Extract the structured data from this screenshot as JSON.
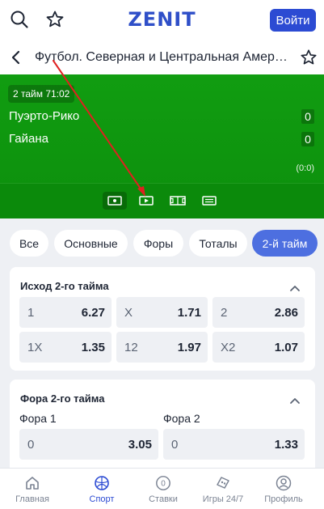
{
  "header": {
    "logo": "ZENIT",
    "login_label": "Войти"
  },
  "event": {
    "title": "Футбол. Северная и Центральная Америка",
    "period": "2 тайм 71:02",
    "team1": "Пуэрто-Рико",
    "team2": "Гайана",
    "score1": "0",
    "score2": "0",
    "subscore": "(0:0)"
  },
  "filters": [
    "Все",
    "Основные",
    "Форы",
    "Тоталы",
    "2-й тайм"
  ],
  "market1": {
    "title": "Исход 2-го тайма",
    "odds": [
      {
        "label": "1",
        "value": "6.27"
      },
      {
        "label": "X",
        "value": "1.71"
      },
      {
        "label": "2",
        "value": "2.86"
      },
      {
        "label": "1X",
        "value": "1.35"
      },
      {
        "label": "12",
        "value": "1.97"
      },
      {
        "label": "X2",
        "value": "1.07"
      }
    ]
  },
  "market2": {
    "title": "Фора 2-го тайма",
    "col1": "Фора 1",
    "col2": "Фора 2",
    "odds": [
      {
        "label": "0",
        "value": "3.05"
      },
      {
        "label": "0",
        "value": "1.33"
      }
    ]
  },
  "nav": [
    {
      "label": "Главная",
      "icon": "home-icon"
    },
    {
      "label": "Спорт",
      "icon": "ball-icon"
    },
    {
      "label": "Ставки",
      "icon": "bets-icon",
      "badge": "0"
    },
    {
      "label": "Игры 24/7",
      "icon": "games-icon"
    },
    {
      "label": "Профиль",
      "icon": "profile-icon"
    }
  ],
  "colors": {
    "brand": "#2c4bd3",
    "field_green": "#0c8f0c",
    "active_chip": "#4d6fe0",
    "annotation_arrow": "#e02020"
  }
}
